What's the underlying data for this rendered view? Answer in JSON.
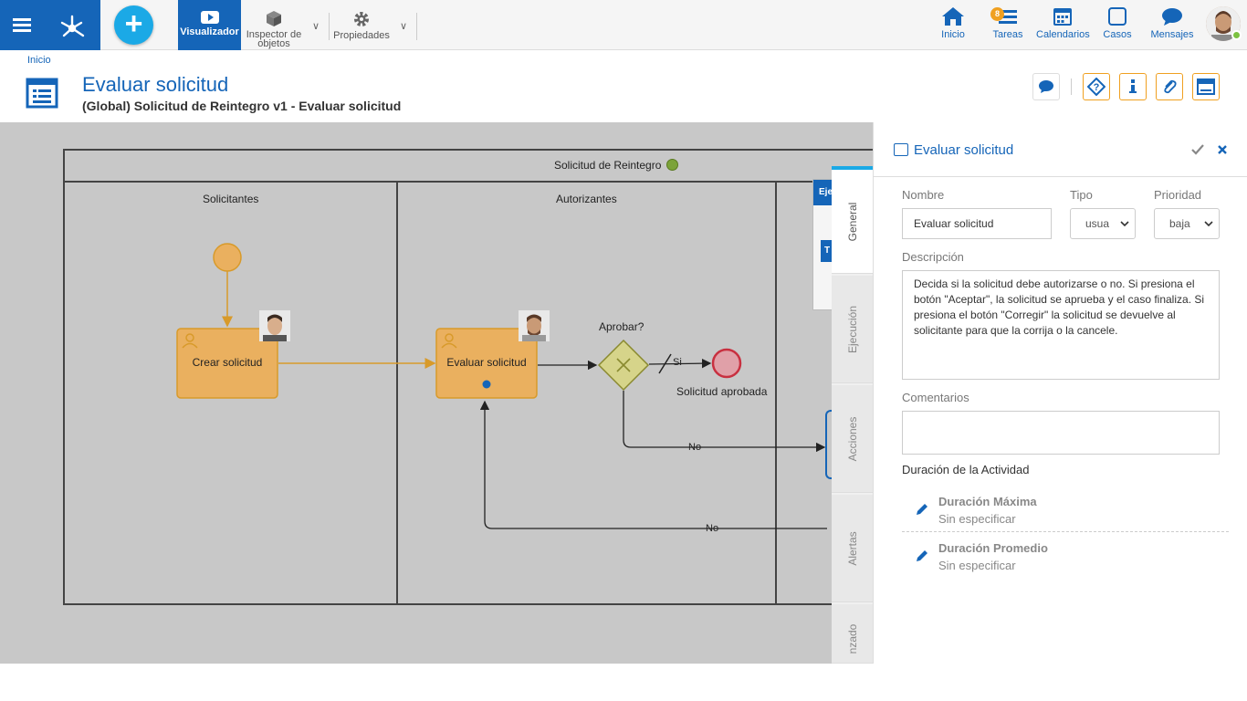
{
  "toolbar": {
    "visualizador_label": "Visualizador",
    "inspector_label_1": "Inspector de",
    "inspector_label_2": "objetos",
    "propiedades_label": "Propiedades"
  },
  "nav": {
    "inicio": "Inicio",
    "tareas": "Tareas",
    "tareas_badge": "8",
    "calendarios": "Calendarios",
    "casos": "Casos",
    "mensajes": "Mensajes"
  },
  "page": {
    "breadcrumb": "Inicio",
    "title": "Evaluar solicitud",
    "subtitle": "(Global) Solicitud de Reintegro v1 - Evaluar solicitud"
  },
  "diagram": {
    "pool_name": "Solicitud de Reintegro",
    "lanes": [
      "Solicitantes",
      "Autorizantes"
    ],
    "task_crear": "Crear solicitud",
    "task_evaluar": "Evaluar solicitud",
    "gateway_label": "Aprobar?",
    "flow_si": "Si",
    "flow_no_1": "No",
    "flow_no_2": "No",
    "end_label": "Solicitud aprobada",
    "partial_1": "Eje",
    "partial_2": "T"
  },
  "tabs": [
    "General",
    "Ejecución",
    "Acciones",
    "Alertas",
    "nzado"
  ],
  "panel": {
    "title": "Evaluar solicitud",
    "nombre_label": "Nombre",
    "nombre_value": "Evaluar solicitud",
    "tipo_label": "Tipo",
    "tipo_value": "usua",
    "prioridad_label": "Prioridad",
    "prioridad_value": "baja",
    "descripcion_label": "Descripción",
    "descripcion_value": "Decida si la solicitud debe autorizarse o no. Si presiona el botón \"Aceptar\", la solicitud se aprueba y el caso finaliza. Si presiona el botón \"Corregir\" la solicitud se devuelve al solicitante para que la corrija o la cancele.",
    "comentarios_label": "Comentarios",
    "comentarios_value": "",
    "duracion_label": "Duración de la Actividad",
    "dur_max_title": "Duración Máxima",
    "dur_max_value": "Sin especificar",
    "dur_prom_title": "Duración Promedio",
    "dur_prom_value": "Sin especificar"
  },
  "colors": {
    "brand": "#1565b8",
    "accent": "#1ba9e6",
    "task_fill": "#eab05f",
    "task_border": "#d89a2a",
    "pool_status": "#7ca33a"
  }
}
